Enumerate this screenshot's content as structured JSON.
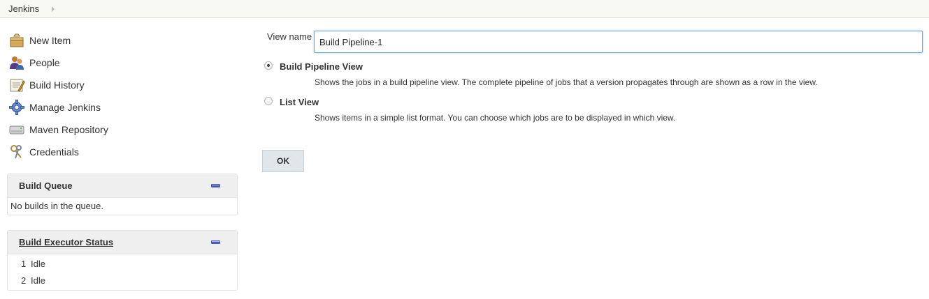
{
  "breadcrumb": {
    "items": [
      "Jenkins"
    ]
  },
  "sidebar": {
    "tasks": [
      {
        "label": "New Item",
        "icon": "new-item-icon"
      },
      {
        "label": "People",
        "icon": "people-icon"
      },
      {
        "label": "Build History",
        "icon": "build-history-icon"
      },
      {
        "label": "Manage Jenkins",
        "icon": "gear-icon"
      },
      {
        "label": "Maven Repository",
        "icon": "disk-icon"
      },
      {
        "label": "Credentials",
        "icon": "keys-icon"
      }
    ],
    "build_queue": {
      "title": "Build Queue",
      "empty_text": "No builds in the queue."
    },
    "executor_status": {
      "title": "Build Executor Status",
      "executors": [
        {
          "num": "1",
          "status": "Idle"
        },
        {
          "num": "2",
          "status": "Idle"
        }
      ]
    }
  },
  "form": {
    "view_name_label": "View name",
    "view_name_value": "Build Pipeline-1",
    "options": [
      {
        "label": "Build Pipeline View",
        "description": "Shows the jobs in a build pipeline view. The complete pipeline of jobs that a version propagates through are shown as a row in the view.",
        "selected": true
      },
      {
        "label": "List View",
        "description": "Shows items in a simple list format. You can choose which jobs are to be displayed in which view.",
        "selected": false
      }
    ],
    "ok_label": "OK"
  },
  "colors": {
    "accent_blue": "#4a5db0",
    "input_focus": "#5fa8e0",
    "pane_header": "#efefef"
  }
}
